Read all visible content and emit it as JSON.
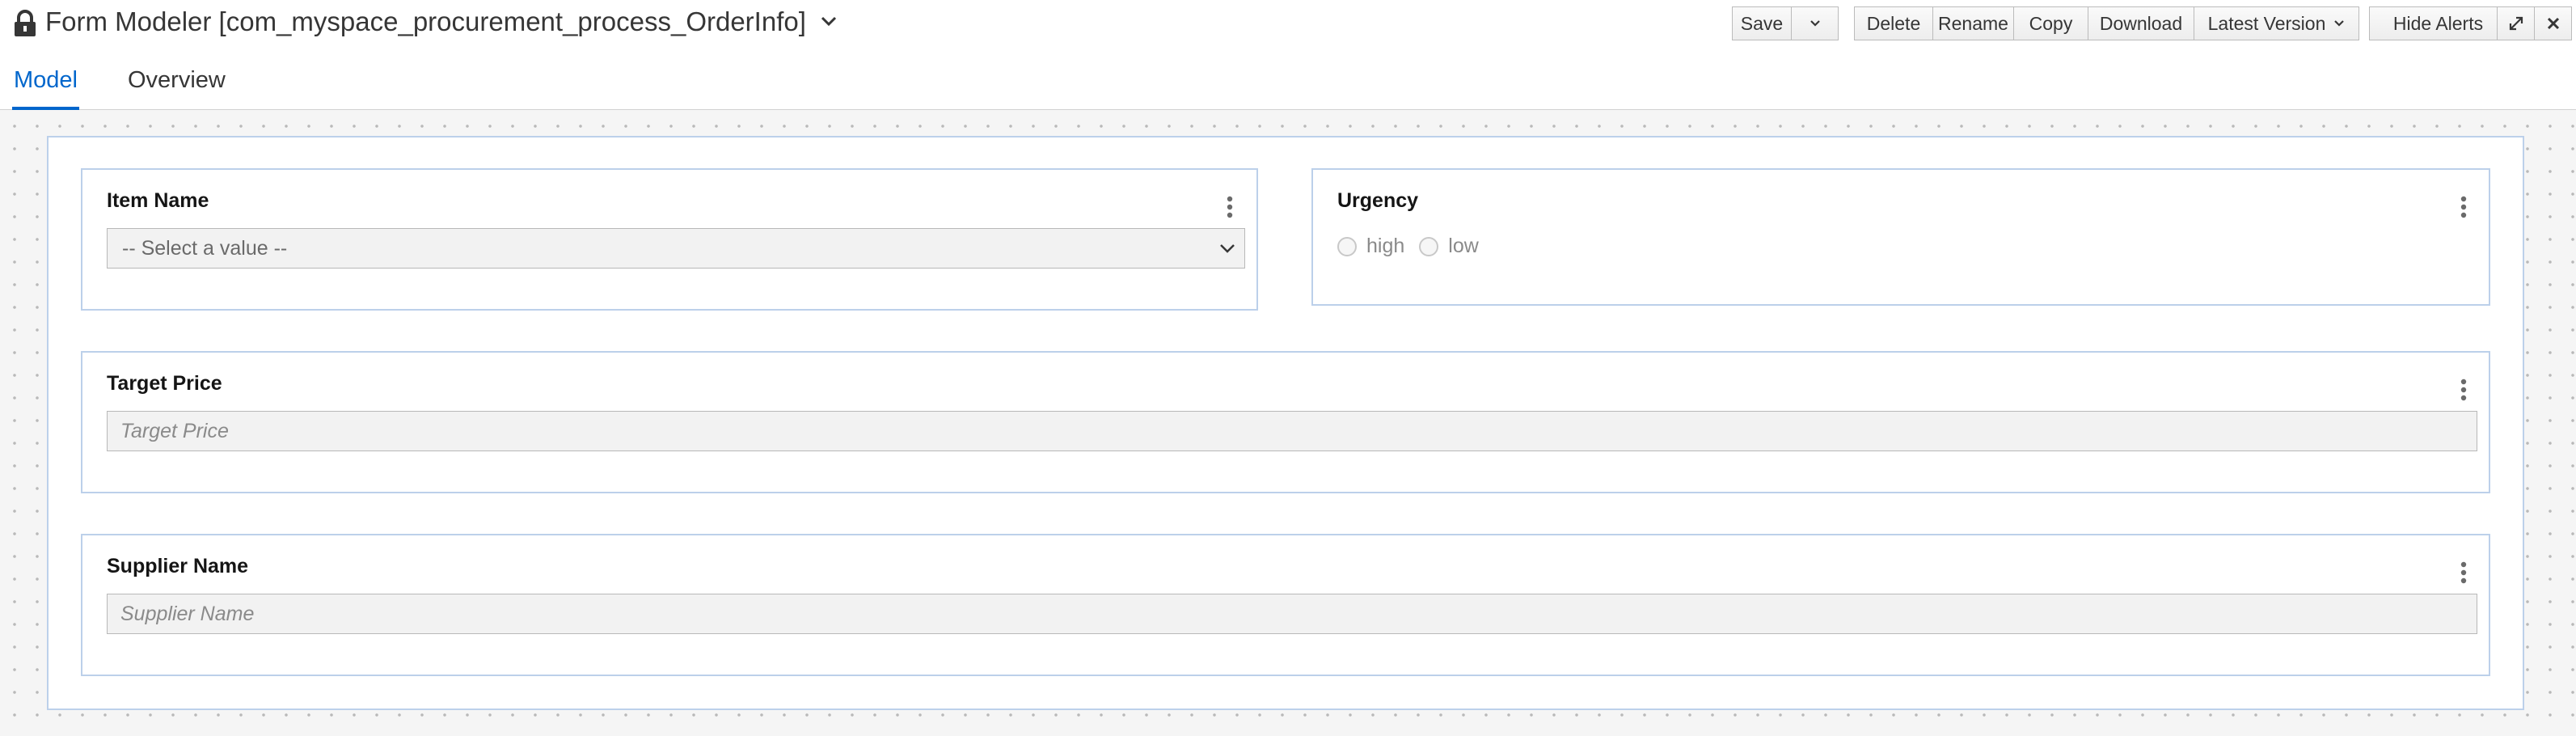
{
  "header": {
    "title": "Form Modeler [com_myspace_procurement_process_OrderInfo]",
    "lock_icon": "lock-icon",
    "buttons": {
      "save": "Save",
      "delete": "Delete",
      "rename": "Rename",
      "copy": "Copy",
      "download": "Download",
      "latest_version": "Latest Version",
      "hide_alerts": "Hide Alerts"
    }
  },
  "tabs": [
    {
      "label": "Model",
      "active": true
    },
    {
      "label": "Overview",
      "active": false
    }
  ],
  "form": {
    "fields": {
      "item_name": {
        "label": "Item Name",
        "select_value": "-- Select a value --"
      },
      "urgency": {
        "label": "Urgency",
        "options": [
          "high",
          "low"
        ]
      },
      "target_price": {
        "label": "Target Price",
        "placeholder": "Target Price"
      },
      "supplier_name": {
        "label": "Supplier Name",
        "placeholder": "Supplier Name"
      }
    }
  },
  "colors": {
    "accent": "#0066cc",
    "field_border": "#bcd0ea",
    "canvas_bg": "#f5f5f5"
  }
}
